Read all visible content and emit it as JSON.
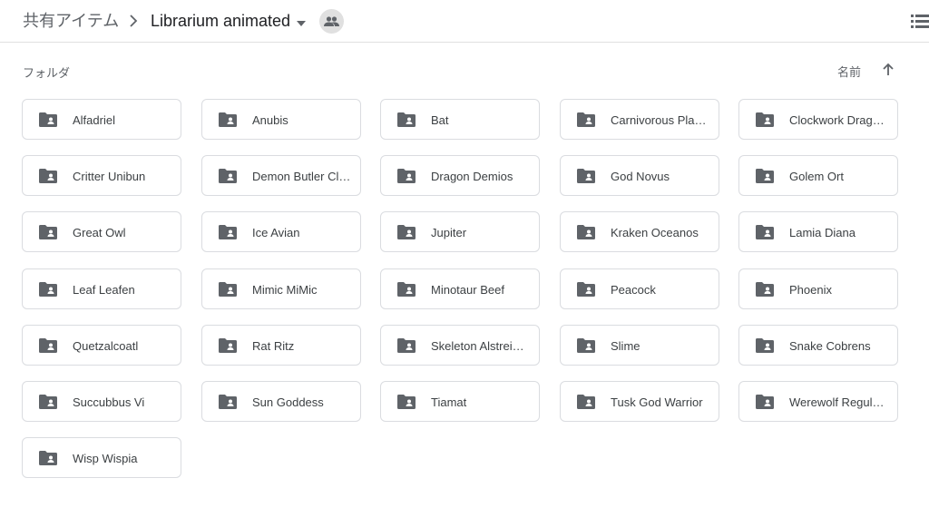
{
  "breadcrumb": {
    "root": "共有アイテム",
    "current": "Librarium animated"
  },
  "icons": {
    "separator": "chevron-right-icon",
    "caret": "caret-down-icon",
    "shared": "people-icon",
    "view": "list-view-icon",
    "sort": "arrow-up-icon",
    "folder": "shared-folder-icon"
  },
  "section": {
    "label": "フォルダ",
    "sort_label": "名前"
  },
  "folders": [
    {
      "name": "Alfadriel"
    },
    {
      "name": "Anubis"
    },
    {
      "name": "Bat"
    },
    {
      "name": "Carnivorous Plant…"
    },
    {
      "name": "Clockwork Drago…"
    },
    {
      "name": "Critter Unibun"
    },
    {
      "name": "Demon Butler Clo…"
    },
    {
      "name": "Dragon Demios"
    },
    {
      "name": "God Novus"
    },
    {
      "name": "Golem Ort"
    },
    {
      "name": "Great Owl"
    },
    {
      "name": "Ice Avian"
    },
    {
      "name": "Jupiter"
    },
    {
      "name": "Kraken Oceanos"
    },
    {
      "name": "Lamia Diana"
    },
    {
      "name": "Leaf Leafen"
    },
    {
      "name": "Mimic MiMic"
    },
    {
      "name": "Minotaur Beef"
    },
    {
      "name": "Peacock"
    },
    {
      "name": "Phoenix"
    },
    {
      "name": "Quetzalcoatl"
    },
    {
      "name": "Rat Ritz"
    },
    {
      "name": "Skeleton Alstreim…"
    },
    {
      "name": "Slime"
    },
    {
      "name": "Snake Cobrens"
    },
    {
      "name": "Succubbus Vi"
    },
    {
      "name": "Sun Goddess"
    },
    {
      "name": "Tiamat"
    },
    {
      "name": "Tusk God Warrior"
    },
    {
      "name": "Werewolf Regulu…"
    },
    {
      "name": "Wisp Wispia"
    }
  ],
  "colors": {
    "icon": "#5f6368",
    "border": "#dadce0",
    "text": "#3c4043"
  }
}
